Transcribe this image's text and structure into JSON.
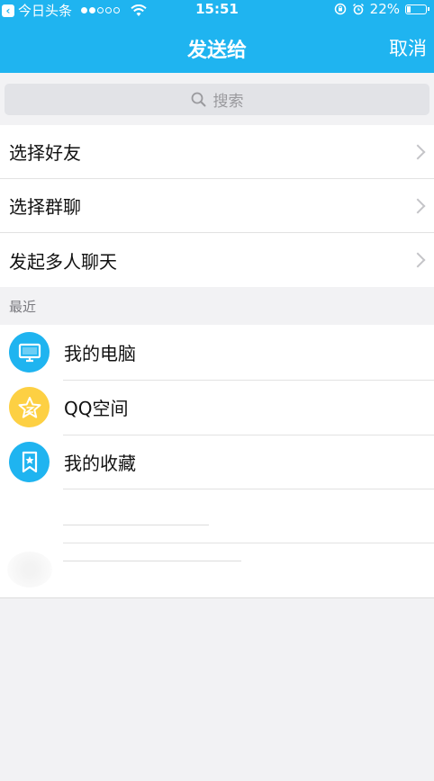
{
  "status_bar": {
    "back_app": "今日头条",
    "time": "15:51",
    "battery": "22%",
    "battery_level": 0.22
  },
  "nav": {
    "title": "发送给",
    "cancel": "取消"
  },
  "search": {
    "placeholder": "搜索"
  },
  "menu": [
    {
      "label": "选择好友"
    },
    {
      "label": "选择群聊"
    },
    {
      "label": "发起多人聊天"
    }
  ],
  "section": {
    "recent": "最近"
  },
  "recent_items": [
    {
      "label": "我的电脑",
      "icon": "computer-icon",
      "color": "#1fb4f0"
    },
    {
      "label": "QQ空间",
      "icon": "star-icon",
      "color": "#fdd043"
    },
    {
      "label": "我的收藏",
      "icon": "bookmark-icon",
      "color": "#1fb4f0"
    }
  ],
  "colors": {
    "accent": "#1fb4f0",
    "background": "#f2f2f4"
  }
}
